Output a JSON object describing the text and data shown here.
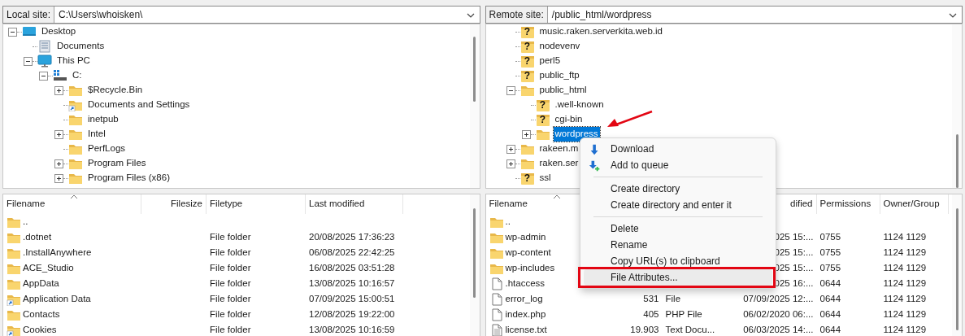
{
  "local": {
    "site_label": "Local site:",
    "path": "C:\\Users\\whoisken\\",
    "tree": [
      {
        "label": "Desktop",
        "kind": "desktop",
        "expanded": true,
        "selected": false,
        "children": [
          {
            "label": "Documents",
            "kind": "documents",
            "selected": false
          },
          {
            "label": "This PC",
            "kind": "computer",
            "expanded": true,
            "selected": false,
            "children": [
              {
                "label": "C:",
                "kind": "drive",
                "expanded": true,
                "selected": false,
                "children": [
                  {
                    "label": "$Recycle.Bin",
                    "kind": "folder",
                    "expanded": false,
                    "selected": false
                  },
                  {
                    "label": "Documents and Settings",
                    "kind": "shortcut",
                    "selected": false
                  },
                  {
                    "label": "inetpub",
                    "kind": "folder",
                    "selected": false
                  },
                  {
                    "label": "Intel",
                    "kind": "folder",
                    "expanded": false,
                    "selected": false
                  },
                  {
                    "label": "PerfLogs",
                    "kind": "folder",
                    "selected": false
                  },
                  {
                    "label": "Program Files",
                    "kind": "folder",
                    "expanded": false,
                    "selected": false
                  },
                  {
                    "label": "Program Files (x86)",
                    "kind": "folder",
                    "expanded": false,
                    "selected": false
                  }
                ]
              }
            ]
          }
        ]
      }
    ],
    "list": {
      "headers": {
        "name": "Filename",
        "size": "Filesize",
        "type": "Filetype",
        "modified": "Last modified"
      },
      "rows": [
        {
          "kind": "folder",
          "name": ".."
        },
        {
          "kind": "folder",
          "name": ".dotnet",
          "type": "File folder",
          "modified": "20/08/2025 17:36:23"
        },
        {
          "kind": "folder",
          "name": ".InstallAnywhere",
          "type": "File folder",
          "modified": "06/08/2025 22:42:25"
        },
        {
          "kind": "folder",
          "name": "ACE_Studio",
          "type": "File folder",
          "modified": "16/08/2025 03:51:28"
        },
        {
          "kind": "folder",
          "name": "AppData",
          "type": "File folder",
          "modified": "13/08/2025 10:16:57"
        },
        {
          "kind": "shortcut",
          "name": "Application Data",
          "type": "File folder",
          "modified": "07/09/2025 15:00:51"
        },
        {
          "kind": "folder",
          "name": "Contacts",
          "type": "File folder",
          "modified": "12/08/2025 19:22:00"
        },
        {
          "kind": "shortcut",
          "name": "Cookies",
          "type": "File folder",
          "modified": "13/08/2025 10:16:59"
        }
      ]
    }
  },
  "remote": {
    "site_label": "Remote site:",
    "path": "/public_html/wordpress",
    "tree": [
      {
        "label": "music.raken.serverkita.web.id",
        "kind": "unknown",
        "icon_glyph": "?",
        "selected": false
      },
      {
        "label": "nodevenv",
        "kind": "unknown",
        "icon_glyph": "?",
        "selected": false
      },
      {
        "label": "perl5",
        "kind": "unknown",
        "icon_glyph": "?",
        "selected": false
      },
      {
        "label": "public_ftp",
        "kind": "unknown",
        "icon_glyph": "?",
        "selected": false
      },
      {
        "label": "public_html",
        "kind": "folder",
        "expanded": true,
        "selected": false,
        "children": [
          {
            "label": ".well-known",
            "kind": "unknown",
            "icon_glyph": "?",
            "selected": false
          },
          {
            "label": "cgi-bin",
            "kind": "unknown",
            "icon_glyph": "?",
            "selected": false
          },
          {
            "label": "wordpress",
            "kind": "folder",
            "expanded": false,
            "selected": true
          }
        ]
      },
      {
        "label": "rakeen.m",
        "kind": "folder",
        "expanded": false,
        "selected": false
      },
      {
        "label": "raken.ser",
        "kind": "folder",
        "expanded": false,
        "selected": false
      },
      {
        "label": "ssl",
        "kind": "unknown",
        "icon_glyph": "?",
        "selected": false
      }
    ],
    "list": {
      "headers": {
        "name": "Filename",
        "modified": "dified",
        "perm": "Permissions",
        "owner": "Owner/Group"
      },
      "rows": [
        {
          "kind": "folder",
          "name": ".."
        },
        {
          "kind": "folder",
          "name": "wp-admin",
          "modified": "025 15:...",
          "perm": "0755",
          "owner": "1124 1129"
        },
        {
          "kind": "folder",
          "name": "wp-content",
          "modified": "025 15:...",
          "perm": "0755",
          "owner": "1124 1129"
        },
        {
          "kind": "folder",
          "name": "wp-includes",
          "modified": "025 15:...",
          "perm": "0755",
          "owner": "1124 1129"
        },
        {
          "kind": "file",
          "name": ".htaccess",
          "modified": "025 16:...",
          "perm": "0644",
          "owner": "1124 1129"
        },
        {
          "kind": "file",
          "name": "error_log",
          "size": "531",
          "type": "File",
          "modified": "07/09/2025 12:...",
          "perm": "0644",
          "owner": "1124 1129"
        },
        {
          "kind": "file",
          "name": "index.php",
          "size": "405",
          "type": "PHP File",
          "modified": "06/02/2020 06:...",
          "perm": "0644",
          "owner": "1124 1129"
        },
        {
          "kind": "textfile",
          "name": "license.txt",
          "size": "19.903",
          "type": "Text Docu...",
          "modified": "06/03/2025 14:...",
          "perm": "0644",
          "owner": "1124 1129"
        }
      ]
    }
  },
  "context_menu": {
    "groups": [
      [
        {
          "label": "Download",
          "kind": "download",
          "highlighted": false
        },
        {
          "label": "Add to queue",
          "kind": "queue",
          "highlighted": false
        }
      ],
      [
        {
          "label": "Create directory",
          "highlighted": false
        },
        {
          "label": "Create directory and enter it",
          "highlighted": false
        }
      ],
      [
        {
          "label": "Delete",
          "highlighted": false
        },
        {
          "label": "Rename",
          "highlighted": false
        },
        {
          "label": "Copy URL(s) to clipboard",
          "highlighted": false
        },
        {
          "label": "File Attributes...",
          "highlighted": true
        }
      ]
    ]
  }
}
